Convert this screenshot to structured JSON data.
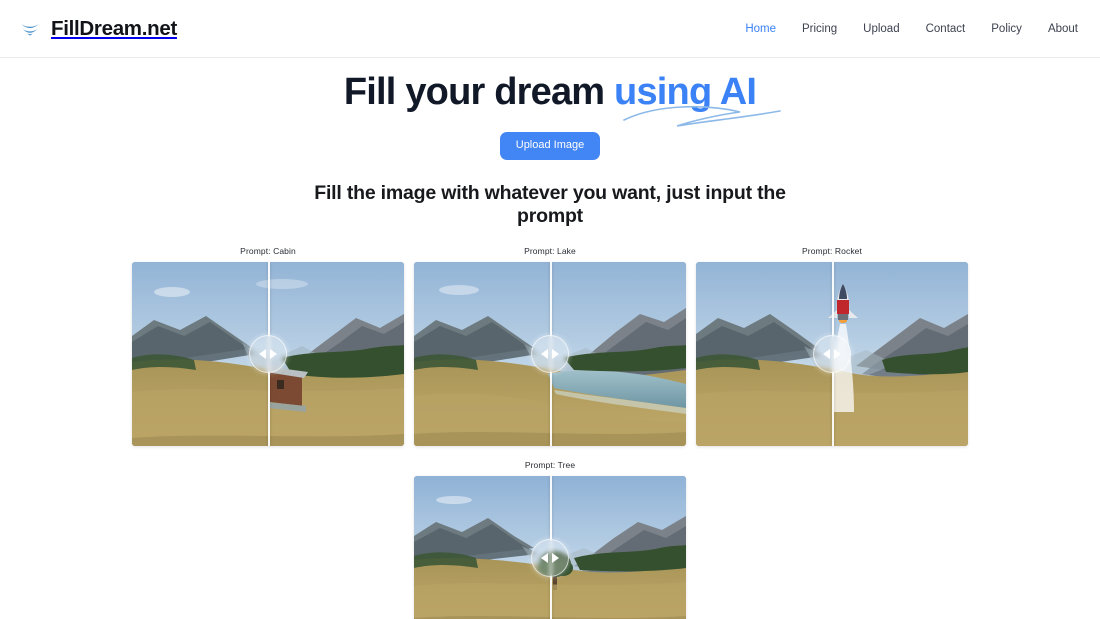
{
  "header": {
    "logo_icon": "double-chevron-down-icon",
    "brand": "FillDream.net",
    "brand_color": "#12141a",
    "accent_color": "#3b82f6",
    "nav": [
      {
        "label": "Home",
        "active": true
      },
      {
        "label": "Pricing",
        "active": false
      },
      {
        "label": "Upload",
        "active": false
      },
      {
        "label": "Contact",
        "active": false
      },
      {
        "label": "Policy",
        "active": false
      },
      {
        "label": "About",
        "active": false
      }
    ]
  },
  "hero": {
    "headline_plain": "Fill your dream ",
    "headline_accent": "using AI",
    "cta_label": "Upload Image",
    "cta_color": "#4285f4",
    "subheadline": "Fill the image with whatever you want, just input the prompt"
  },
  "gallery": {
    "items": [
      {
        "label": "Prompt: Cabin",
        "prompt": "Cabin",
        "slider_percent": 50,
        "handle_icon": "left-right-arrows-icon",
        "before_alt": "Mountain valley with golden grass meadow",
        "after_alt": "Mountain valley with a wooden cabin added"
      },
      {
        "label": "Prompt: Lake",
        "prompt": "Lake",
        "slider_percent": 50,
        "handle_icon": "left-right-arrows-icon",
        "before_alt": "Mountain valley with golden grass meadow",
        "after_alt": "Mountain valley with a reflective lake added"
      },
      {
        "label": "Prompt: Rocket",
        "prompt": "Rocket",
        "slider_percent": 50,
        "handle_icon": "left-right-arrows-icon",
        "before_alt": "Mountain valley with golden grass meadow",
        "after_alt": "Mountain valley with a rocket launching and smoke trail"
      },
      {
        "label": "Prompt: Tree",
        "prompt": "Tree",
        "slider_percent": 50,
        "handle_icon": "left-right-arrows-icon",
        "before_alt": "Mountain valley with golden grass meadow",
        "after_alt": "Mountain valley with a tree added"
      }
    ]
  }
}
